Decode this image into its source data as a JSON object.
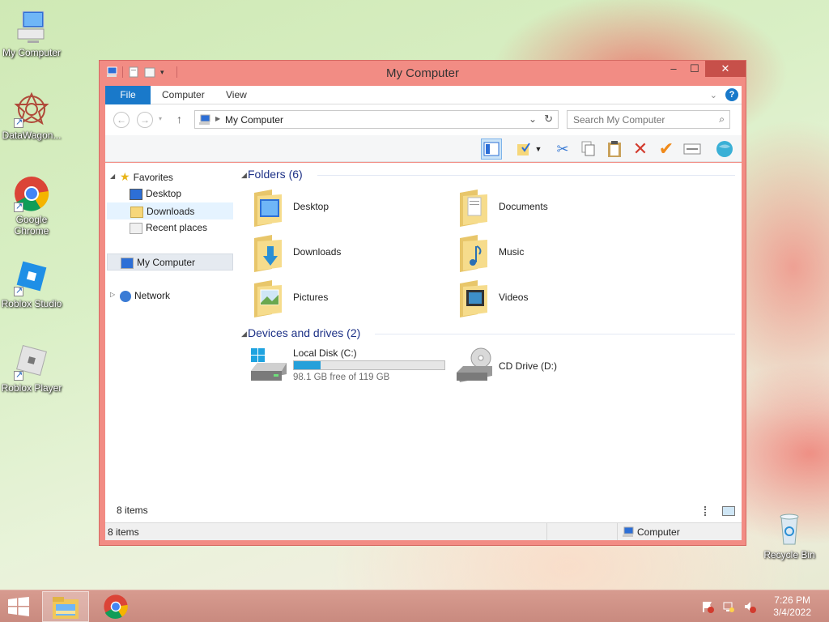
{
  "desktop": {
    "icons": [
      {
        "label": "My Computer"
      },
      {
        "label": "DataWagon..."
      },
      {
        "label": "Google Chrome"
      },
      {
        "label": "Roblox Studio"
      },
      {
        "label": "Roblox Player"
      },
      {
        "label": "Recycle Bin"
      }
    ]
  },
  "window": {
    "title": "My Computer",
    "tabs": {
      "file": "File",
      "computer": "Computer",
      "view": "View"
    },
    "help": "?",
    "address": "My Computer",
    "search_placeholder": "Search My Computer",
    "nav": {
      "favorites": "Favorites",
      "desktop": "Desktop",
      "downloads": "Downloads",
      "recent": "Recent places",
      "my_computer": "My Computer",
      "network": "Network"
    },
    "folders_header": "Folders (6)",
    "folders": [
      "Desktop",
      "Documents",
      "Downloads",
      "Music",
      "Pictures",
      "Videos"
    ],
    "drives_header": "Devices and drives (2)",
    "drives": {
      "c_label": "Local Disk (C:)",
      "c_free": "98.1 GB free of 119 GB",
      "c_used_fraction": 0.176,
      "d_label": "CD Drive (D:)"
    },
    "item_count": "8 items",
    "status_left": "8 items",
    "status_right": "Computer"
  },
  "taskbar": {
    "time": "7:26 PM",
    "date": "3/4/2022"
  },
  "colors": {
    "window_frame": "#f28c84",
    "accent": "#1979ca",
    "progress": "#26a0da",
    "taskbar": "#cf9286"
  }
}
